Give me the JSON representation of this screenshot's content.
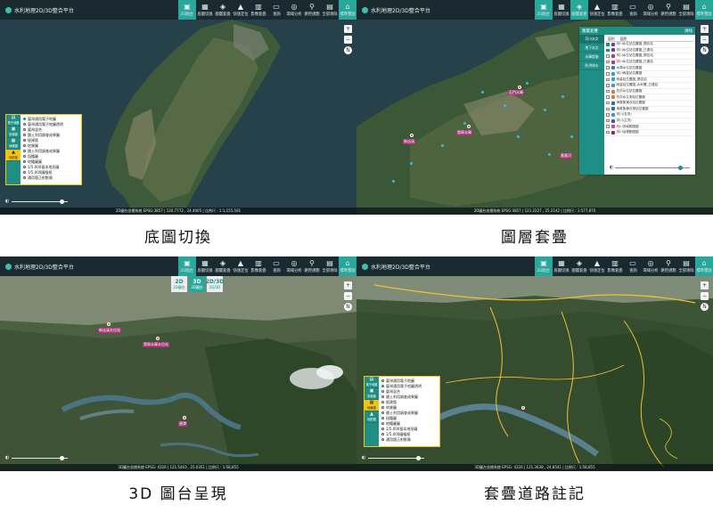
{
  "app": {
    "title": "水利地理2D/3D整合平台"
  },
  "toolbar": {
    "items": [
      {
        "label": "2D圖台",
        "icon": "2d-icon"
      },
      {
        "label": "底圖切換",
        "icon": "basemap-icon"
      },
      {
        "label": "圖層套疊",
        "icon": "layers-icon"
      },
      {
        "label": "快速定位",
        "icon": "locate-icon"
      },
      {
        "label": "影像套疊",
        "icon": "image-overlay-icon"
      },
      {
        "label": "查詢",
        "icon": "query-icon"
      },
      {
        "label": "環域分析",
        "icon": "buffer-icon"
      },
      {
        "label": "路徑規劃",
        "icon": "route-icon"
      },
      {
        "label": "全部清除",
        "icon": "clear-icon"
      },
      {
        "label": "標準畫面",
        "icon": "default-view-icon"
      }
    ]
  },
  "captions": [
    "底圖切換",
    "圖層套疊",
    "3D 圖台呈現",
    "套疊道路註記"
  ],
  "status": [
    "2D圖台坐標系統 EPSG:3857 | 120.7772 , 24.4005 | 比例尺 : 1:1,155,581",
    "2D圖台坐標系統 EPSG:3857 | 121.2227 , 25.2142 | 比例尺 : 1:577,870",
    "3D圖台坐標系統 EPSG: 4326 | 121.5403 , 25.0351 | 比例尺 : 1:58,855",
    "3D圖台坐標系統 EPSG: 4326 | 121.3638 , 24.8541 | 比例尺 : 1:58,855"
  ],
  "basemap": {
    "tabs": [
      "電子地圖",
      "影像圖",
      "線畫圖",
      "地形圖"
    ],
    "items": [
      "臺灣通用電子地圖",
      "臺灣通用電子地圖透明",
      "臺灣混合",
      "國土利用調查成果圖",
      "經建版",
      "地質圖",
      "國土利用調查成果圖",
      "段籍圖",
      "地籍圖圖",
      "1/5,000基本地形圖",
      "1/5,000圖幅框",
      "通用版正射影像"
    ]
  },
  "layers": {
    "header": "圖層套疊",
    "close": "清除",
    "categories": [
      "河川水文",
      "地下水文",
      "水庫設施",
      "防洪排水"
    ],
    "col_symbol": "圖例",
    "col_name": "圖層",
    "rows": [
      "河川水位站位置圖_預告站",
      "河川水位站位置圖_已連站",
      "河川水位站位置圖_預告站",
      "河川水位站位置圖_已連站",
      "水庫水位站位置圖",
      "河川雨量站位置圖",
      "雨量站位置圖_預告站",
      "雨量站位置圖_水利署_已連站",
      "抗洪水位站位置圖",
      "抗洪水文測站位置圖",
      "海氣象潮汐站位置圖",
      "海氣象潮汐測站位置圖",
      "河川(支流)",
      "河川(主流)",
      "河川流域範圍圖",
      "河川治理範圍圖"
    ],
    "checked": [
      true,
      true,
      false,
      false,
      false,
      false,
      false,
      false,
      false,
      false,
      false,
      false,
      false,
      false,
      false,
      false
    ],
    "symbol_colors": [
      "#6a3fa0",
      "#6a3fa0",
      "#b03a8a",
      "#b03a8a",
      "#2f7fc1",
      "#3a9ad9",
      "#3a9ad9",
      "#3a9ad9",
      "#e07a2c",
      "#e07a2c",
      "#2b6cb0",
      "#2b6cb0",
      "#4f8fe0",
      "#1f5fc0",
      "#c05090",
      "#803080"
    ]
  },
  "map2_labels": [
    "石門水庫",
    "翡翠水庫",
    "新店溪",
    "基隆河"
  ],
  "map3_labels": [
    "翡翠水庫水位站",
    "新店溪水位站",
    "碧潭"
  ],
  "dim_switch": [
    {
      "big": "2D",
      "label": "2D圖台"
    },
    {
      "big": "3D",
      "label": "3D圖台"
    },
    {
      "big": "2D/3D",
      "label": "2D/3D"
    }
  ],
  "slider": {
    "icon": "🌗",
    "opacity": 0.85
  },
  "nav": {
    "compass": "N",
    "zoom_in": "+",
    "zoom_out": "−"
  }
}
